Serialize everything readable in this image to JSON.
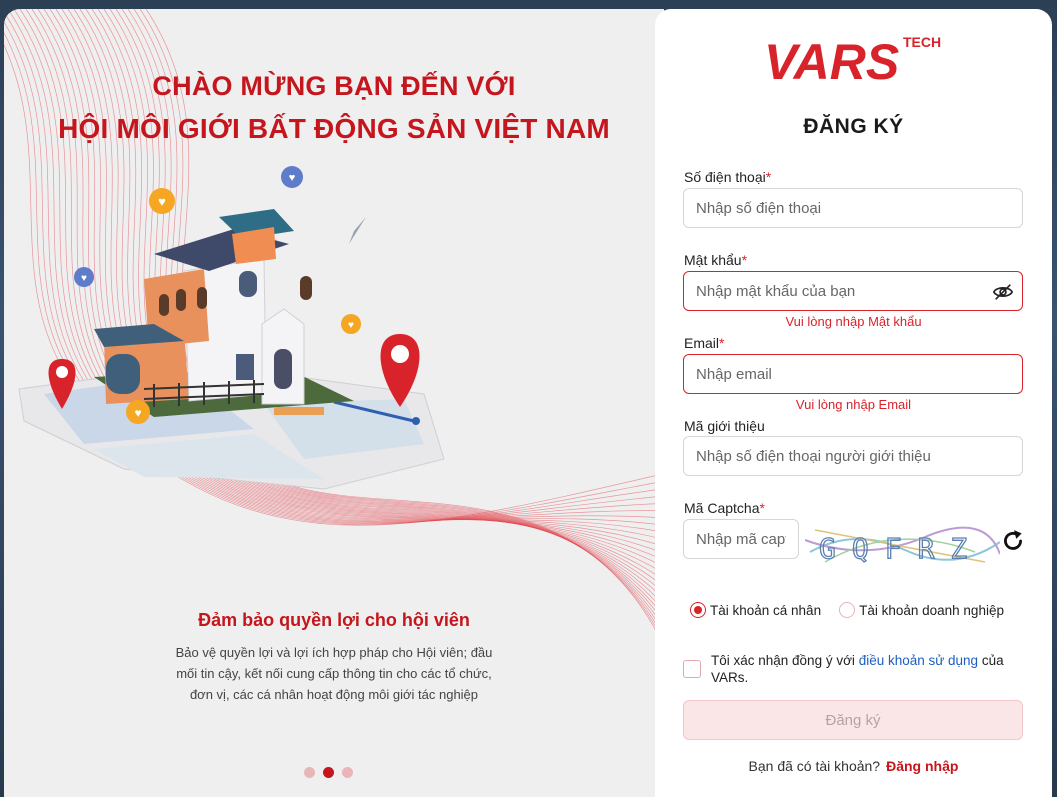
{
  "welcome": {
    "line1": "CHÀO MỪNG BẠN ĐẾN VỚI",
    "line2": "HỘI MÔI GIỚI BẤT ĐỘNG SẢN VIỆT NAM"
  },
  "slide": {
    "title": "Đảm bảo quyền lợi cho hội viên",
    "description": "Bảo vệ quyền lợi và lợi ích hợp pháp cho Hội viên; đầu mối tin cậy, kết nối cung cấp thông tin cho các tổ chức, đơn vị, các cá nhân hoạt động môi giới tác nghiệp",
    "dot_count": 3,
    "active_index": 1
  },
  "logo": {
    "main": "VARS",
    "sub": "TECH"
  },
  "form": {
    "title": "ĐĂNG KÝ",
    "phone": {
      "label": "Số điện thoại",
      "required": "*",
      "placeholder": "Nhập số điện thoại"
    },
    "password": {
      "label": "Mật khẩu",
      "required": "*",
      "placeholder": "Nhập mật khẩu của bạn",
      "error": "Vui lòng nhập Mật khẩu"
    },
    "email": {
      "label": "Email",
      "required": "*",
      "placeholder": "Nhập email",
      "error": "Vui lòng nhập Email"
    },
    "referral": {
      "label": "Mã giới thiệu",
      "placeholder": "Nhập số điện thoại người giới thiệu"
    },
    "captcha": {
      "label": "Mã Captcha",
      "required": "*",
      "placeholder": "Nhập mã captcha",
      "image_text": "GQFRZ"
    },
    "account_types": [
      {
        "label": "Tài khoản cá nhân",
        "selected": true
      },
      {
        "label": "Tài khoản doanh nghiệp",
        "selected": false
      }
    ],
    "agree": {
      "prefix": "Tôi xác nhận đồng ý với ",
      "link": "điều khoản sử dụng",
      "suffix": " của VARs."
    },
    "submit_label": "Đăng ký",
    "login_prompt": "Bạn đã có tài khoản?",
    "login_link": "Đăng nhập"
  },
  "colors": {
    "brand_red": "#c4161c",
    "error_red": "#d9232b",
    "link_blue": "#1d5fbf"
  },
  "icons": [
    "eye-off-icon",
    "refresh-icon",
    "map-pin-icon",
    "heart-bubble-icon",
    "house-illustration"
  ]
}
